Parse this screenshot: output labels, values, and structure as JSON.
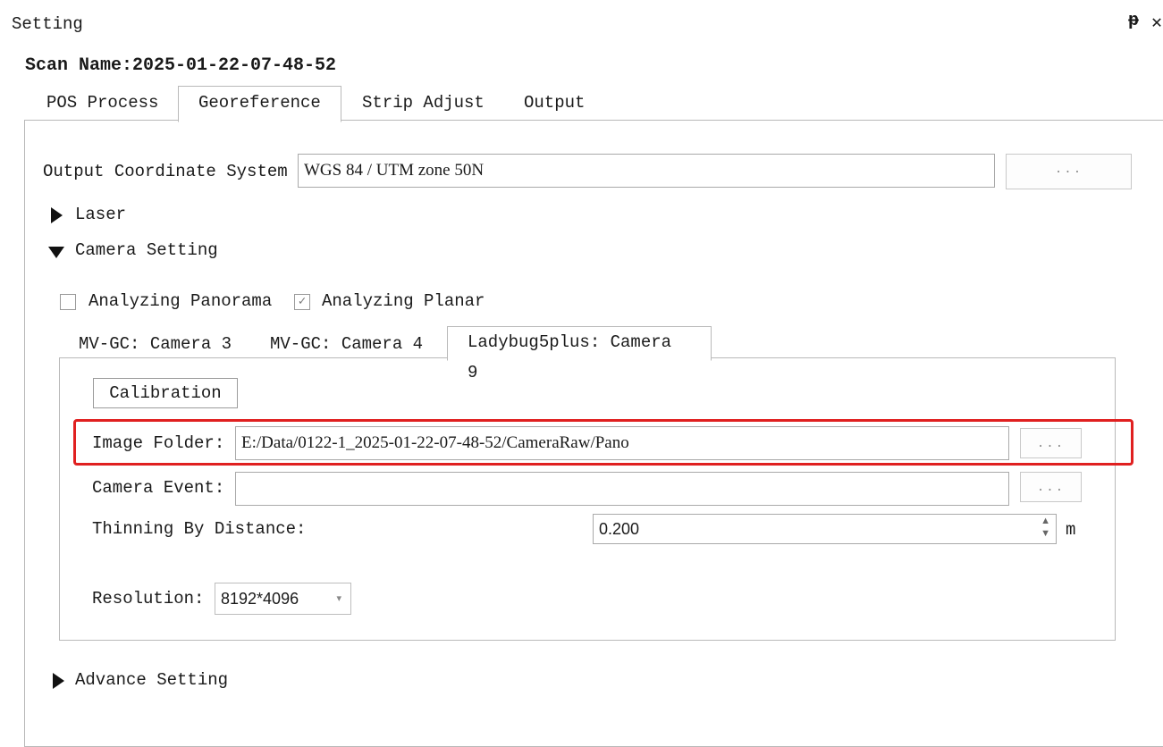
{
  "window": {
    "title": "Setting",
    "pin_icon": "pin-icon",
    "close_icon": "close-icon"
  },
  "scan_name": "Scan Name:2025-01-22-07-48-52",
  "tabs": [
    {
      "label": "POS Process",
      "active": false
    },
    {
      "label": "Georeference",
      "active": true
    },
    {
      "label": "Strip Adjust",
      "active": false
    },
    {
      "label": "Output",
      "active": false
    }
  ],
  "georeference": {
    "output_cs_label": "Output Coordinate System",
    "output_cs_value": "WGS 84 / UTM zone 50N",
    "browse_label": "...",
    "laser_label": "Laser",
    "camera_setting_label": "Camera Setting",
    "analyzing_panorama": {
      "label": "Analyzing Panorama",
      "checked": false
    },
    "analyzing_planar": {
      "label": "Analyzing Planar",
      "checked": true
    },
    "camera_tabs": [
      {
        "label": "MV-GC: Camera 3",
        "active": false
      },
      {
        "label": "MV-GC: Camera 4",
        "active": false
      },
      {
        "label": "Ladybug5plus: Camera 9",
        "active": true
      }
    ],
    "calibration_label": "Calibration",
    "image_folder_label": "Image Folder:",
    "image_folder_value": "E:/Data/0122-1_2025-01-22-07-48-52/CameraRaw/Pano",
    "camera_event_label": "Camera Event:",
    "camera_event_value": "",
    "thinning_label": "Thinning By Distance:",
    "thinning_value": "0.200",
    "thinning_unit": "m",
    "resolution_label": "Resolution:",
    "resolution_value": "8192*4096",
    "advance_setting_label": "Advance Setting"
  },
  "colors": {
    "highlight": "#e02020",
    "border": "#b9b9b9"
  }
}
